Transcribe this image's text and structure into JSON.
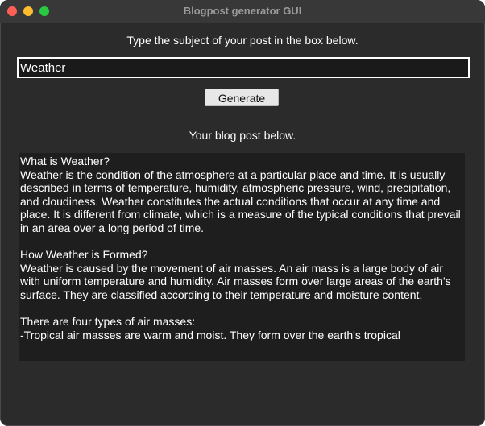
{
  "window": {
    "title": "Blogpost generator GUI"
  },
  "form": {
    "instruction": "Type the subject of your post in the box below.",
    "subject_value": "Weather",
    "generate_label": "Generate"
  },
  "output": {
    "label": "Your blog post below.",
    "text": "What is Weather?\nWeather is the condition of the atmosphere at a particular place and time. It is usually described in terms of temperature, humidity, atmospheric pressure, wind, precipitation, and cloudiness. Weather constitutes the actual conditions that occur at any time and place. It is different from climate, which is a measure of the typical conditions that prevail in an area over a long period of time.\n\nHow Weather is Formed?\nWeather is caused by the movement of air masses. An air mass is a large body of air with uniform temperature and humidity. Air masses form over large areas of the earth's surface. They are classified according to their temperature and moisture content.\n\nThere are four types of air masses:\n-Tropical air masses are warm and moist. They form over the earth's tropical"
  },
  "colors": {
    "window_bg": "#2b2b2b",
    "titlebar_bg": "#383838",
    "close": "#fe5f57",
    "minimize": "#febc2e",
    "maximize": "#28c840",
    "text_area_bg": "#1e1e1e",
    "input_border": "#ffffff",
    "button_bg": "#e7e7e7"
  }
}
